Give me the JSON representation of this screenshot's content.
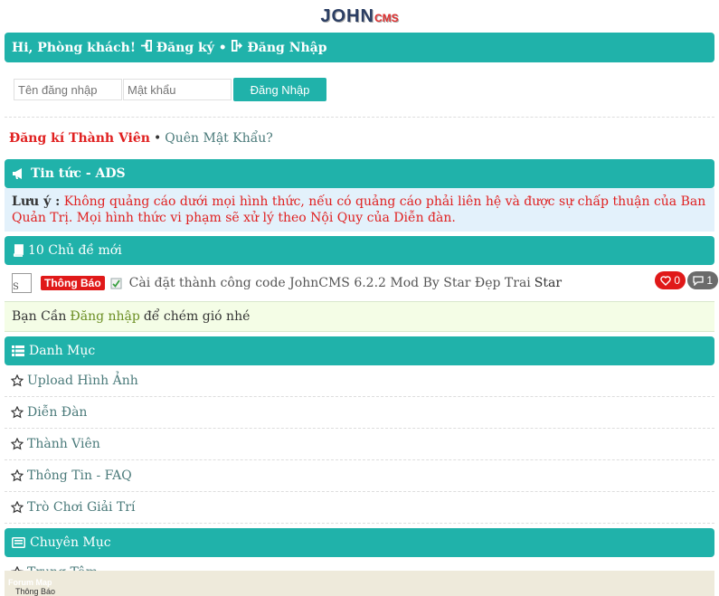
{
  "logo": {
    "main": "JOHN",
    "suffix": "CMS"
  },
  "header": {
    "greeting": "Hi, Phòng khách!",
    "register": "Đăng ký",
    "separator": "•",
    "login": "Đăng Nhập"
  },
  "login_form": {
    "username_placeholder": "Tên đăng nhập",
    "password_placeholder": "Mật khẩu",
    "submit_label": "Đăng Nhập"
  },
  "links": {
    "register_member": "Đăng kí Thành Viên",
    "separator": "•",
    "forgot_password": "Quên Mật Khẩu?"
  },
  "news": {
    "title": "Tin tức - ADS",
    "note_label": "Lưu ý :",
    "note_text": "Không quảng cáo dưới mọi hình thức, nếu có quảng cáo phải liên hệ và được sự chấp thuận của Ban Quản Trị. Mọi hình thức vi phạm sẽ xử lý theo Nội Quy của Diễn đàn."
  },
  "latest_topics": {
    "title": "10 Chủ đề mới",
    "items": [
      {
        "thumb_alt": "S",
        "badge": "Thông Báo",
        "title": "Cài đặt thành công code JohnCMS 6.2.2 Mod By Star Đẹp Trai",
        "author": "Star",
        "likes": "0",
        "comments": "1"
      }
    ]
  },
  "chat": {
    "prefix": "Bạn Cần",
    "link": "Đăng nhập",
    "suffix": "để chém gió nhé"
  },
  "categories": {
    "title": "Danh Mục",
    "items": [
      "Upload Hình Ảnh",
      "Diễn Đàn",
      "Thành Viên",
      "Thông Tin - FAQ",
      "Trò Chơi Giải Trí"
    ]
  },
  "sections": {
    "title": "Chuyên Mục",
    "items": [
      "Trung Tâm"
    ]
  },
  "footer": {
    "line1": "Forum Map",
    "line2": "Thông Báo"
  },
  "colors": {
    "accent": "#20b2aa",
    "danger": "#e01919",
    "notice_bg": "#e3f1fb",
    "chat_bg": "#f4fde6"
  }
}
